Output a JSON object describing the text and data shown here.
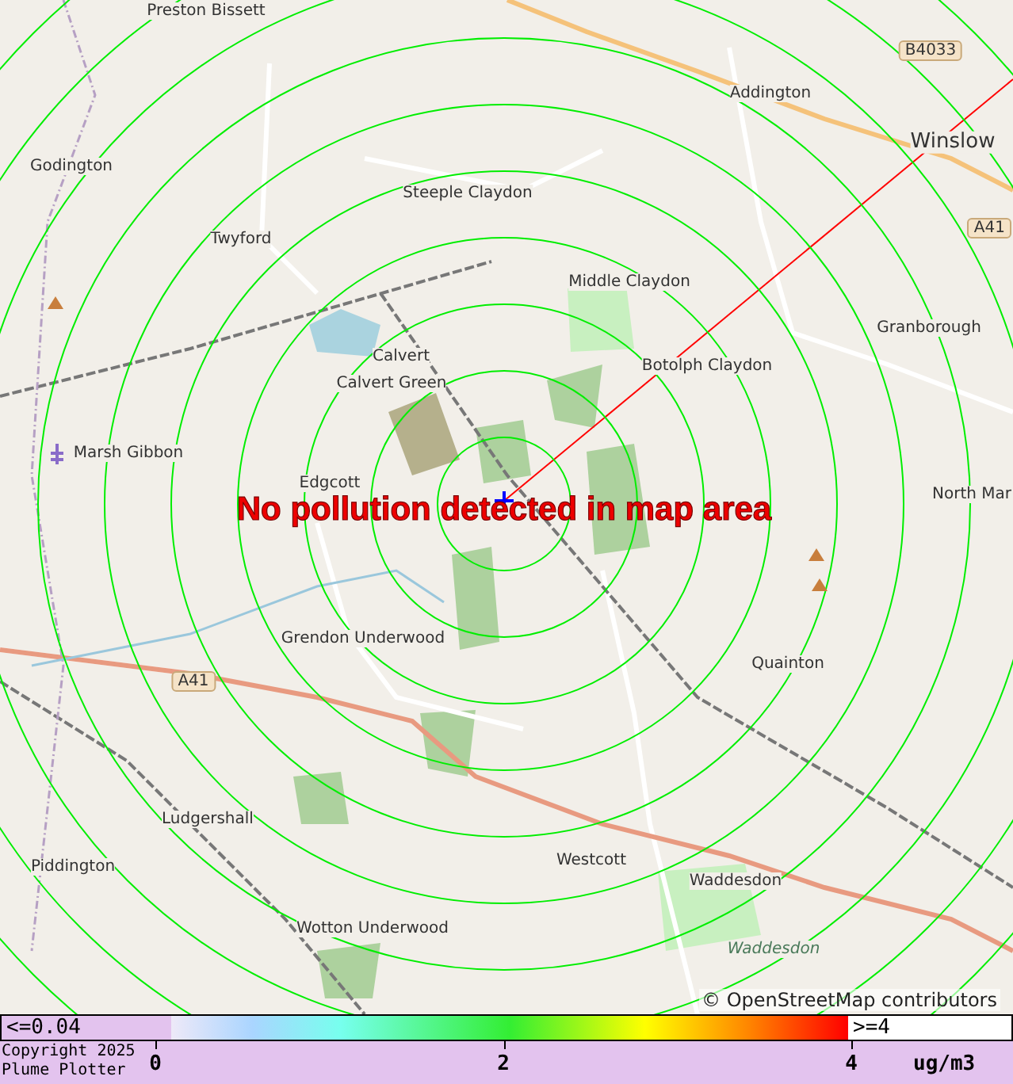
{
  "map": {
    "places": [
      {
        "name": "Preston Bissett",
        "kind": "village"
      },
      {
        "name": "Godington",
        "kind": "village"
      },
      {
        "name": "Twyford",
        "kind": "village"
      },
      {
        "name": "Steeple Claydon",
        "kind": "village"
      },
      {
        "name": "Addington",
        "kind": "village"
      },
      {
        "name": "Winslow",
        "kind": "town"
      },
      {
        "name": "Middle Claydon",
        "kind": "village"
      },
      {
        "name": "Granborough",
        "kind": "village"
      },
      {
        "name": "Botolph Claydon",
        "kind": "village"
      },
      {
        "name": "Calvert",
        "kind": "village"
      },
      {
        "name": "Calvert Green",
        "kind": "village"
      },
      {
        "name": "Marsh Gibbon",
        "kind": "village"
      },
      {
        "name": "Edgcott",
        "kind": "village"
      },
      {
        "name": "North Mar",
        "kind": "village"
      },
      {
        "name": "Grendon Underwood",
        "kind": "village"
      },
      {
        "name": "Quainton",
        "kind": "village"
      },
      {
        "name": "Ludgershall",
        "kind": "village"
      },
      {
        "name": "Piddington",
        "kind": "village"
      },
      {
        "name": "Westcott",
        "kind": "village"
      },
      {
        "name": "Waddesdon",
        "kind": "village"
      },
      {
        "name": "Wotton Underwood",
        "kind": "village"
      },
      {
        "name": "Waddesdon",
        "kind": "estate"
      },
      {
        "name": "B4033",
        "kind": "road"
      },
      {
        "name": "A41",
        "kind": "road"
      },
      {
        "name": "A41",
        "kind": "road"
      }
    ],
    "message": "No pollution detected in map area",
    "attribution": "© OpenStreetMap contributors"
  },
  "legend": {
    "low_label": "<=0.04",
    "high_label": ">=4",
    "ticks": [
      "0",
      "2",
      "4"
    ],
    "unit": "ug/m3",
    "copyright": [
      "Copyright 2025",
      "Plume Plotter"
    ]
  }
}
